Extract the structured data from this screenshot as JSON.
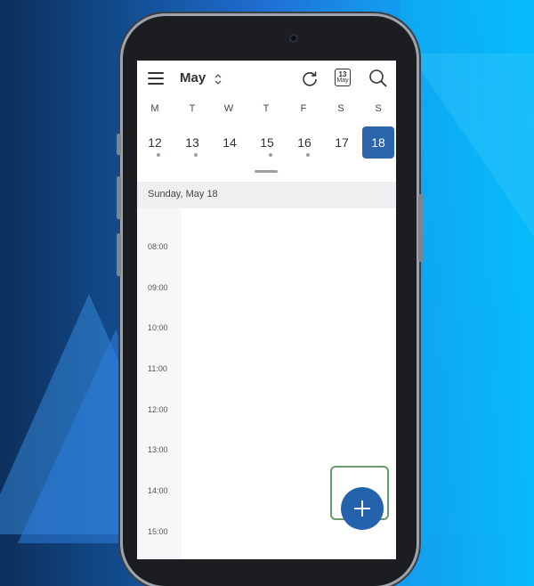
{
  "toolbar": {
    "month_label": "May",
    "month_chevron": "⌃\n⌄",
    "today_icon": {
      "day": "13",
      "month": "May"
    },
    "icons": [
      "menu-icon",
      "chevron-up-down-icon",
      "refresh-icon",
      "today-calendar-icon",
      "search-icon"
    ]
  },
  "week": {
    "weekdays": [
      "M",
      "T",
      "W",
      "T",
      "F",
      "S",
      "S"
    ],
    "dates": [
      {
        "label": "12",
        "has_events": true,
        "selected": false
      },
      {
        "label": "13",
        "has_events": true,
        "selected": false
      },
      {
        "label": "14",
        "has_events": false,
        "selected": false
      },
      {
        "label": "15",
        "has_events": true,
        "selected": false
      },
      {
        "label": "16",
        "has_events": true,
        "selected": false
      },
      {
        "label": "17",
        "has_events": false,
        "selected": false
      },
      {
        "label": "18",
        "has_events": false,
        "selected": true
      }
    ]
  },
  "day_header": "Sunday, May 18",
  "hours": [
    "08:00",
    "09:00",
    "10:00",
    "11:00",
    "12:00",
    "13:00",
    "14:00",
    "15:00"
  ],
  "fab": {
    "icon": "plus-icon"
  },
  "colors": {
    "accent": "#2b66ad",
    "fab": "#2463ac",
    "fab_outline": "#6a9b6a"
  }
}
